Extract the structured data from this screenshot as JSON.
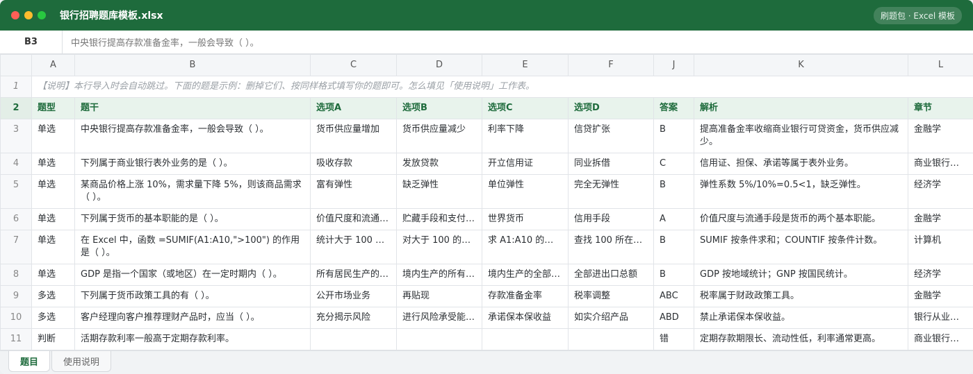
{
  "window": {
    "title": "银行招聘题库模板.xlsx",
    "badge": "刷题包 · Excel 模板"
  },
  "formula_bar": {
    "cell_ref": "B3",
    "content": "中央银行提高存款准备金率，一般会导致（ ）。"
  },
  "columns": [
    "A",
    "B",
    "C",
    "D",
    "E",
    "F",
    "J",
    "K",
    "L"
  ],
  "notice_row": {
    "num": "1",
    "text": "【说明】本行导入时会自动跳过。下面的题是示例：删掉它们、按同样格式填写你的题即可。怎么填见「使用说明」工作表。"
  },
  "header_row": {
    "num": "2",
    "cells": [
      "题型",
      "题干",
      "选项A",
      "选项B",
      "选项C",
      "选项D",
      "答案",
      "解析",
      "章节"
    ]
  },
  "rows": [
    {
      "num": "3",
      "cells": [
        "单选",
        "中央银行提高存款准备金率，一般会导致（ ）。",
        "货币供应量增加",
        "货币供应量减少",
        "利率下降",
        "信贷扩张",
        "B",
        "提高准备金率收缩商业银行可贷资金，货币供应减少。",
        "金融学"
      ]
    },
    {
      "num": "4",
      "cells": [
        "单选",
        "下列属于商业银行表外业务的是（ ）。",
        "吸收存款",
        "发放贷款",
        "开立信用证",
        "同业拆借",
        "C",
        "信用证、担保、承诺等属于表外业务。",
        "商业银行…"
      ]
    },
    {
      "num": "5",
      "cells": [
        "单选",
        "某商品价格上涨 10%，需求量下降 5%，则该商品需求（ ）。",
        "富有弹性",
        "缺乏弹性",
        "单位弹性",
        "完全无弹性",
        "B",
        "弹性系数 5%/10%=0.5<1，缺乏弹性。",
        "经济学"
      ]
    },
    {
      "num": "6",
      "cells": [
        "单选",
        "下列属于货币的基本职能的是（ ）。",
        "价值尺度和流通…",
        "贮藏手段和支付…",
        "世界货币",
        "信用手段",
        "A",
        "价值尺度与流通手段是货币的两个基本职能。",
        "金融学"
      ]
    },
    {
      "num": "7",
      "cells": [
        "单选",
        "在 Excel 中，函数 =SUMIF(A1:A10,\">100\") 的作用是（ ）。",
        "统计大于 100 …",
        "对大于 100 的…",
        "求 A1:A10 的平…",
        "查找 100 所在…",
        "B",
        "SUMIF 按条件求和；COUNTIF 按条件计数。",
        "计算机"
      ]
    },
    {
      "num": "8",
      "cells": [
        "单选",
        "GDP 是指一个国家（或地区）在一定时期内（ ）。",
        "所有居民生产的…",
        "境内生产的所有…",
        "境内生产的全部…",
        "全部进出口总额",
        "B",
        "GDP 按地域统计；GNP 按国民统计。",
        "经济学"
      ]
    },
    {
      "num": "9",
      "cells": [
        "多选",
        "下列属于货币政策工具的有（ ）。",
        "公开市场业务",
        "再贴现",
        "存款准备金率",
        "税率调整",
        "ABC",
        "税率属于财政政策工具。",
        "金融学"
      ]
    },
    {
      "num": "10",
      "cells": [
        "多选",
        "客户经理向客户推荐理财产品时，应当（ ）。",
        "充分揭示风险",
        "进行风险承受能…",
        "承诺保本保收益",
        "如实介绍产品",
        "ABD",
        "禁止承诺保本保收益。",
        "银行从业…"
      ]
    },
    {
      "num": "11",
      "cells": [
        "判断",
        "活期存款利率一般高于定期存款利率。",
        "",
        "",
        "",
        "",
        "错",
        "定期存款期限长、流动性低，利率通常更高。",
        "商业银行…"
      ]
    }
  ],
  "sheet_tabs": [
    "题目",
    "使用说明"
  ],
  "colors": {
    "accent": "#1e6b3c",
    "header_bg": "#e8f3ec"
  }
}
